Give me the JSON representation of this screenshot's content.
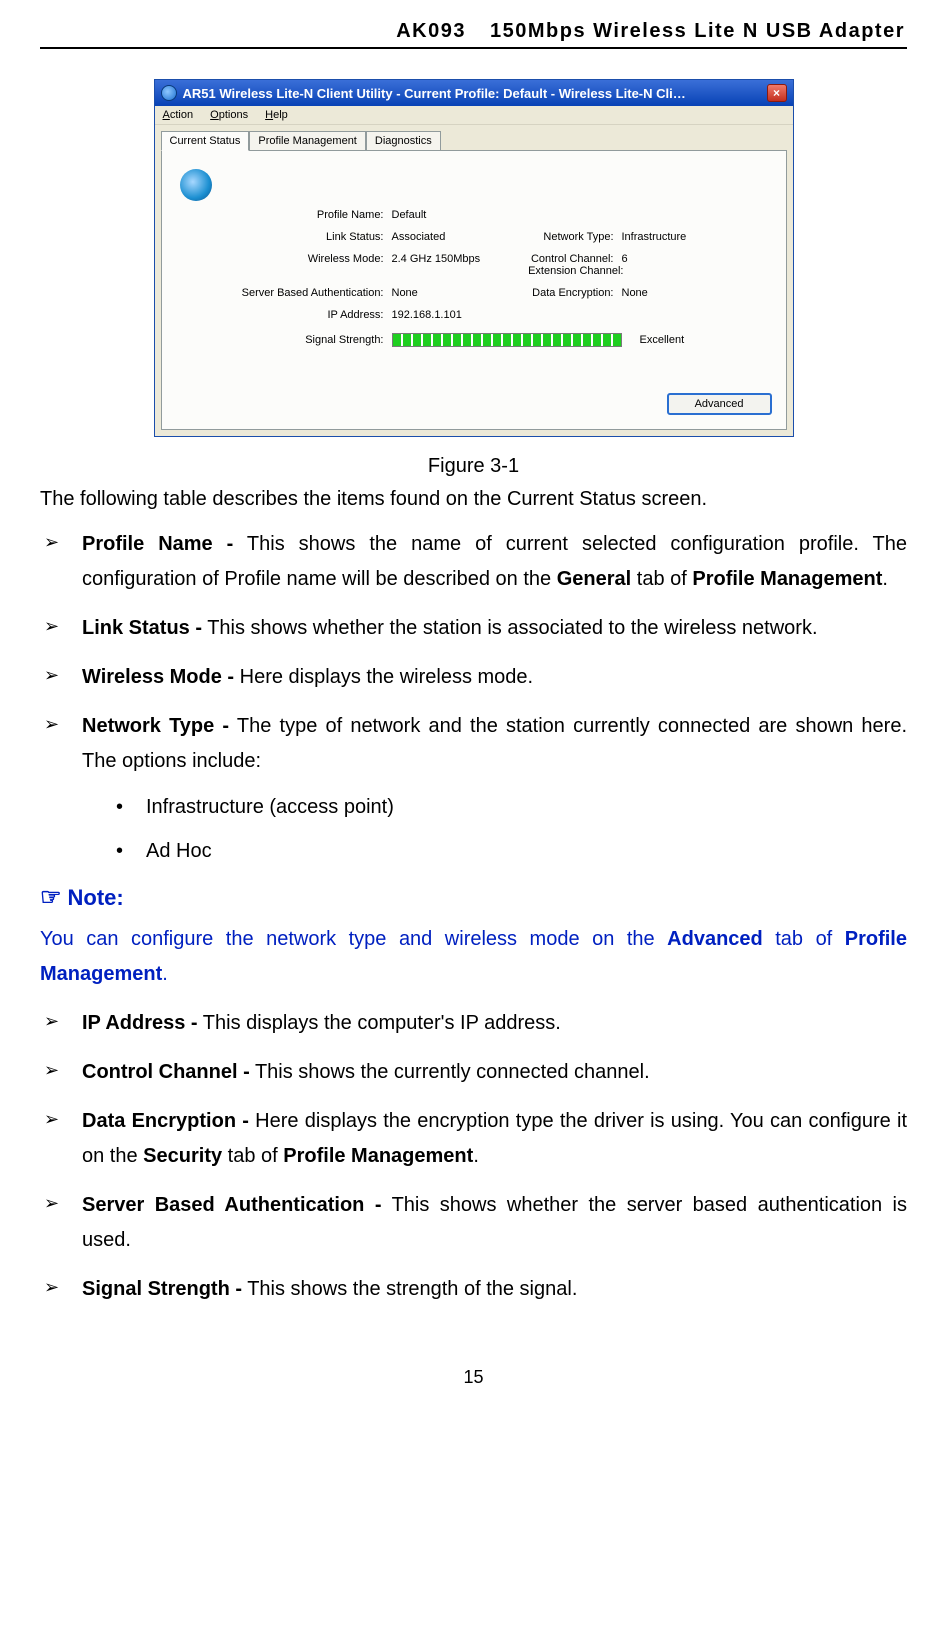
{
  "header": {
    "code": "AK093",
    "product": "150Mbps  Wireless  Lite  N  USB  Adapter"
  },
  "xp": {
    "title": "AR51 Wireless Lite-N Client Utility - Current Profile: Default - Wireless Lite-N Cli…",
    "menu": {
      "action": "Action",
      "options": "Options",
      "help": "Help"
    },
    "tabs": {
      "status": "Current Status",
      "pm": "Profile Management",
      "diag": "Diagnostics"
    },
    "labels": {
      "profile_name": "Profile Name:",
      "link_status": "Link Status:",
      "wireless_mode": "Wireless Mode:",
      "sba": "Server Based Authentication:",
      "ip": "IP Address:",
      "network_type": "Network Type:",
      "control_ch": "Control Channel:",
      "ext_ch": "Extension Channel:",
      "data_enc": "Data Encryption:",
      "signal": "Signal Strength:"
    },
    "values": {
      "profile_name": "Default",
      "link_status": "Associated",
      "wireless_mode": "2.4 GHz 150Mbps",
      "sba": "None",
      "ip": "192.168.1.101",
      "network_type": "Infrastructure",
      "control_ch": "6",
      "ext_ch": "",
      "data_enc": "None",
      "signal_text": "Excellent"
    },
    "advanced_btn": "Advanced"
  },
  "figure_caption": "Figure 3-1",
  "intro": "The following table describes the items found on the Current Status screen.",
  "items": {
    "pn_term": "Profile  Name  -",
    "pn_t1": "  This  shows  the  name  of  current  selected  configuration  profile.  The configuration of Profile name will be described on the ",
    "pn_b1": "General",
    "pn_t2": " tab of ",
    "pn_b2": "Profile Management",
    "pn_t3": ".",
    "ls_term": "Link Status -",
    "ls_desc": " This shows whether the station is associated to the wireless network.",
    "wm_term": "Wireless Mode -",
    "wm_desc": " Here displays the wireless mode.",
    "nt_term": "Network Type -",
    "nt_desc": " The type of network and the station currently connected are shown here. The options include:",
    "nt_sub1": "Infrastructure (access point)",
    "nt_sub2": "Ad Hoc",
    "ip_term": "IP Address -",
    "ip_desc": " This displays the computer's IP address.",
    "cc_term": "Control Channel -",
    "cc_desc": " This shows the currently connected channel.",
    "de_term": "Data Encryption -",
    "de_t1": " Here displays the encryption type the driver is using. You can configure it on the ",
    "de_b1": "Security",
    "de_t2": " tab of ",
    "de_b2": "Profile Management",
    "de_t3": ".",
    "sba_term": "Server  Based  Authentication  -",
    "sba_desc": "  This  shows  whether  the  server  based  authentication  is used.",
    "ss_term": "Signal Strength -",
    "ss_desc": " This shows the strength of the signal."
  },
  "note": {
    "head": "Note:",
    "t1": "You  can  configure  the  network  type  and  wireless  mode  on  the  ",
    "b1": "Advanced",
    "t2": "  tab  of  ",
    "b2": "Profile Management",
    "t3": "."
  },
  "page_num": "15"
}
